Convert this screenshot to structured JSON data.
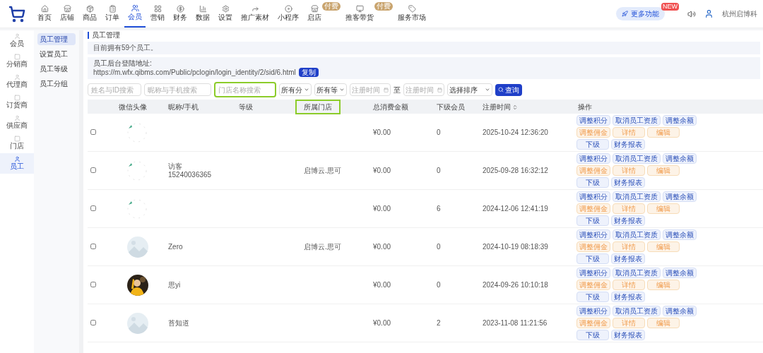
{
  "nav": {
    "items": [
      {
        "label": "首页",
        "selected": false
      },
      {
        "label": "店铺",
        "selected": false
      },
      {
        "label": "商品",
        "selected": false
      },
      {
        "label": "订单",
        "selected": false
      },
      {
        "label": "会员",
        "selected": true
      },
      {
        "label": "营销",
        "selected": false
      },
      {
        "label": "财务",
        "selected": false
      },
      {
        "label": "数据",
        "selected": false
      },
      {
        "label": "设置",
        "selected": false
      },
      {
        "label": "推广素材",
        "selected": false
      },
      {
        "label": "小程序",
        "selected": false
      },
      {
        "label": "启店",
        "selected": false,
        "badge": "付费"
      },
      {
        "label": "推客带货",
        "selected": false,
        "badge": "付费"
      },
      {
        "label": "服务市场",
        "selected": false
      }
    ],
    "more": {
      "label": "更多功能",
      "badge": "NEW"
    },
    "account": "杭州启博科"
  },
  "sidebar": {
    "items": [
      {
        "label": "会员",
        "selected": false
      },
      {
        "label": "分销商",
        "selected": false
      },
      {
        "label": "代理商",
        "selected": false
      },
      {
        "label": "订货商",
        "selected": false
      },
      {
        "label": "供应商",
        "selected": false
      },
      {
        "label": "门店",
        "selected": false
      },
      {
        "label": "员工",
        "selected": true
      }
    ]
  },
  "subnav": {
    "items": [
      {
        "label": "员工管理",
        "selected": true
      },
      {
        "label": "设置员工",
        "selected": false
      },
      {
        "label": "员工等级",
        "selected": false
      },
      {
        "label": "员工分组",
        "selected": false
      }
    ]
  },
  "page_title": "员工管理",
  "notice": "目前拥有59个员工。",
  "login": {
    "label": "员工后台登陆地址:",
    "url": "https://m.wfx.qibms.com/Public/pclogin/login_identity/2/sid/6.html",
    "button": "复制"
  },
  "filters": {
    "fields": [
      {
        "placeholder": "姓名与ID搜索",
        "highlighted": false
      },
      {
        "placeholder": "昵称与手机搜索",
        "highlighted": false
      },
      {
        "placeholder": "门店名称搜索",
        "highlighted": true
      }
    ],
    "selects": [
      "所有分",
      "所有等"
    ],
    "date_from": "注册时间",
    "between": "至",
    "date_to": "注册时间",
    "sort": "选择排序",
    "search": "查询"
  },
  "table": {
    "columns": [
      {
        "label": "微信头像"
      },
      {
        "label": "昵称/手机"
      },
      {
        "label": "等级"
      },
      {
        "label": "所属门店",
        "highlighted": true
      },
      {
        "label": "总消费金额"
      },
      {
        "label": "下级会员"
      },
      {
        "label": "注册时间",
        "sortable": true
      },
      {
        "label": "操作"
      }
    ],
    "rows": [
      {
        "checked": false,
        "avatar": {
          "kind": "broken"
        },
        "amount": "¥0.00",
        "subs": "0",
        "time": "2025-10-24 12:36:20",
        "actions": [
          {
            "kind": "primary",
            "labels": [
              "调整积分",
              "取消员工资质",
              "调整余额"
            ]
          },
          {
            "kind": "warning",
            "labels": [
              "调整佣金",
              "详情",
              "编辑"
            ]
          },
          {
            "kind": "primary",
            "labels": [
              "下级",
              "财务报表"
            ]
          }
        ]
      },
      {
        "checked": false,
        "avatar": {
          "kind": "broken"
        },
        "name": "访客",
        "phone": "15240036365",
        "store": "启博云.思可",
        "amount": "¥0.00",
        "subs": "0",
        "time": "2025-09-28 16:32:12",
        "actions": [
          {
            "kind": "primary",
            "labels": [
              "调整积分",
              "取消员工资质",
              "调整余额"
            ]
          },
          {
            "kind": "warning",
            "labels": [
              "调整佣金",
              "详情",
              "编辑"
            ]
          },
          {
            "kind": "primary",
            "labels": [
              "下级",
              "财务报表"
            ]
          }
        ]
      },
      {
        "checked": false,
        "avatar": {
          "kind": "broken"
        },
        "amount": "¥0.00",
        "subs": "6",
        "time": "2024-12-06 12:41:19",
        "actions": [
          {
            "kind": "primary",
            "labels": [
              "调整积分",
              "取消员工资质",
              "调整余额"
            ]
          },
          {
            "kind": "warning",
            "labels": [
              "调整佣金",
              "详情",
              "编辑"
            ]
          },
          {
            "kind": "primary",
            "labels": [
              "下级",
              "财务报表"
            ]
          }
        ]
      },
      {
        "checked": false,
        "avatar": {
          "kind": "picture"
        },
        "name": "Zero",
        "store": "启博云.思可",
        "amount": "¥0.00",
        "subs": "0",
        "time": "2024-10-19 08:18:39",
        "actions": [
          {
            "kind": "primary",
            "labels": [
              "调整积分",
              "取消员工资质",
              "调整余额"
            ]
          },
          {
            "kind": "warning",
            "labels": [
              "调整佣金",
              "详情",
              "编辑"
            ]
          },
          {
            "kind": "primary",
            "labels": [
              "下级",
              "财务报表"
            ]
          }
        ]
      },
      {
        "checked": false,
        "avatar": {
          "kind": "picture"
        },
        "name": "思yi",
        "amount": "¥0.00",
        "subs": "0",
        "time": "2024-09-26 10:10:18",
        "actions": [
          {
            "kind": "primary",
            "labels": [
              "调整积分",
              "取消员工资质",
              "调整余额"
            ]
          },
          {
            "kind": "warning",
            "labels": [
              "调整佣金",
              "详情",
              "编辑"
            ]
          },
          {
            "kind": "primary",
            "labels": [
              "下级",
              "财务报表"
            ]
          }
        ]
      },
      {
        "checked": false,
        "avatar": {
          "kind": "picture"
        },
        "name": "苔知道",
        "amount": "¥0.00",
        "subs": "2",
        "time": "2023-11-08 11:21:56",
        "actions": [
          {
            "kind": "primary",
            "labels": [
              "调整积分",
              "取消员工资质",
              "调整余额"
            ]
          },
          {
            "kind": "warning",
            "labels": [
              "调整佣金",
              "详情",
              "编辑"
            ]
          },
          {
            "kind": "primary",
            "labels": [
              "下级",
              "财务报表"
            ]
          }
        ]
      }
    ]
  }
}
